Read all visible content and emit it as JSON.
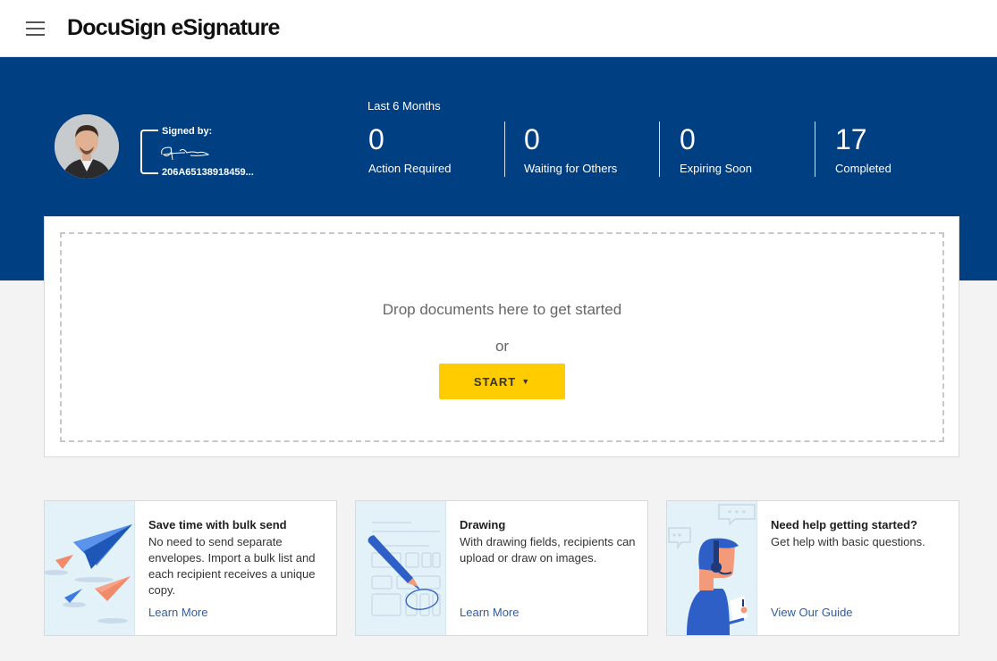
{
  "header": {
    "menu_icon": "hamburger-menu-icon",
    "logo_text": "DocuSign eSignature"
  },
  "profile": {
    "avatar_icon": "user-avatar-photo",
    "signed_by_label": "Signed by:",
    "signature_id": "206A65138918459..."
  },
  "stats": {
    "period_label": "Last 6 Months",
    "items": [
      {
        "value": "0",
        "label": "Action Required"
      },
      {
        "value": "0",
        "label": "Waiting for Others"
      },
      {
        "value": "0",
        "label": "Expiring Soon"
      },
      {
        "value": "17",
        "label": "Completed"
      }
    ]
  },
  "dropzone": {
    "prompt": "Drop documents here to get started",
    "or_text": "or",
    "start_label": "START",
    "start_icon": "caret-down-icon"
  },
  "cards": [
    {
      "title": "Save time with bulk send",
      "description": "No need to send separate envelopes. Import a bulk list and each recipient receives a unique copy.",
      "link": "Learn More",
      "illustration": "paper-planes-illustration"
    },
    {
      "title": "Drawing",
      "description": "With drawing fields, recipients can upload or draw on images.",
      "link": "Learn More",
      "illustration": "pencil-drawing-illustration"
    },
    {
      "title": "Need help getting started?",
      "description": "Get help with basic questions.",
      "link": "View Our Guide",
      "illustration": "support-agent-illustration"
    }
  ],
  "colors": {
    "banner": "#003f82",
    "start_button": "#ffcc00",
    "link": "#2f5ba7",
    "illustration_bg": "#e3f1f8"
  }
}
